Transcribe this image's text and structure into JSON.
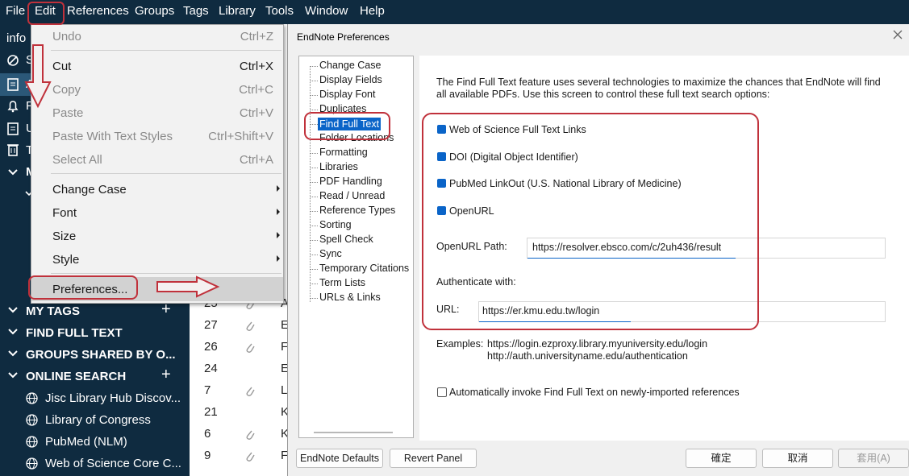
{
  "menubar": {
    "items": [
      "File",
      "Edit",
      "References",
      "Groups",
      "Tags",
      "Library",
      "Tools",
      "Window",
      "Help"
    ]
  },
  "sidebar": {
    "partial_top": [
      "info",
      "S",
      "A",
      "F",
      "U",
      "T",
      "M"
    ],
    "sections": [
      {
        "label": "MY TAGS",
        "plus": "+"
      },
      {
        "label": "FIND FULL TEXT"
      },
      {
        "label": "GROUPS SHARED BY O..."
      },
      {
        "label": "ONLINE SEARCH",
        "plus": "+"
      }
    ],
    "online_items": [
      "Jisc Library Hub Discov...",
      "Library of Congress",
      "PubMed (NLM)",
      "Web of Science Core C..."
    ]
  },
  "reference_list": {
    "rows": [
      {
        "num": "25",
        "clip": true,
        "letter": "A"
      },
      {
        "num": "27",
        "clip": true,
        "letter": "E"
      },
      {
        "num": "26",
        "clip": true,
        "letter": "F"
      },
      {
        "num": "24",
        "clip": false,
        "letter": "E"
      },
      {
        "num": "7",
        "clip": true,
        "letter": "L"
      },
      {
        "num": "21",
        "clip": false,
        "letter": "K"
      },
      {
        "num": "6",
        "clip": true,
        "letter": "K"
      },
      {
        "num": "9",
        "clip": true,
        "letter": "F"
      }
    ]
  },
  "edit_menu": {
    "items": [
      {
        "label": "Undo",
        "shortcut": "Ctrl+Z",
        "disabled": true
      },
      {
        "label": "Cut",
        "shortcut": "Ctrl+X",
        "disabled": false
      },
      {
        "label": "Copy",
        "shortcut": "Ctrl+C",
        "disabled": true
      },
      {
        "label": "Paste",
        "shortcut": "Ctrl+V",
        "disabled": true
      },
      {
        "label": "Paste With Text Styles",
        "shortcut": "Ctrl+Shift+V",
        "disabled": true
      },
      {
        "label": "Select All",
        "shortcut": "Ctrl+A",
        "disabled": true
      },
      {
        "label": "Change Case",
        "submenu": true
      },
      {
        "label": "Font",
        "submenu": true
      },
      {
        "label": "Size",
        "submenu": true
      },
      {
        "label": "Style",
        "submenu": true
      },
      {
        "label": "Preferences...",
        "highlighted": true
      }
    ]
  },
  "dialog": {
    "title": "EndNote Preferences",
    "tree": [
      "Change Case",
      "Display Fields",
      "Display Font",
      "Duplicates",
      "Find Full Text",
      "Folder Locations",
      "Formatting",
      "Libraries",
      "PDF Handling",
      "Read / Unread",
      "Reference Types",
      "Sorting",
      "Spell Check",
      "Sync",
      "Temporary Citations",
      "Term Lists",
      "URLs & Links"
    ],
    "selected_tree_item": "Find Full Text",
    "description_line1": "The Find Full Text feature uses several technologies to maximize the chances that EndNote will find",
    "description_line2": "all available PDFs. Use this screen to control these full text search options:",
    "options": [
      {
        "label": "Web of Science Full Text Links",
        "checked": true
      },
      {
        "label": "DOI (Digital Object Identifier)",
        "checked": true
      },
      {
        "label": "PubMed LinkOut (U.S. National Library of Medicine)",
        "checked": true
      },
      {
        "label": "OpenURL",
        "checked": true
      }
    ],
    "openurl_label": "OpenURL Path:",
    "openurl_value": "https://resolver.ebsco.com/c/2uh436/result",
    "authenticate_label": "Authenticate with:",
    "url_label": "URL:",
    "url_value": "https://er.kmu.edu.tw/login",
    "examples_label": "Examples:",
    "example1": "https://login.ezproxy.library.myuniversity.edu/login",
    "example2": "http://auth.universityname.edu/authentication",
    "auto_invoke_label": "Automatically invoke Find Full Text on newly-imported references",
    "auto_invoke_checked": false,
    "buttons": {
      "defaults": "EndNote Defaults",
      "revert": "Revert Panel",
      "ok": "確定",
      "cancel": "取消",
      "apply": "套用(A)"
    }
  },
  "colors": {
    "sidebar_bg": "#0f2b40",
    "selection_blue": "#0a64c8",
    "annotation_red": "#c0313b"
  }
}
